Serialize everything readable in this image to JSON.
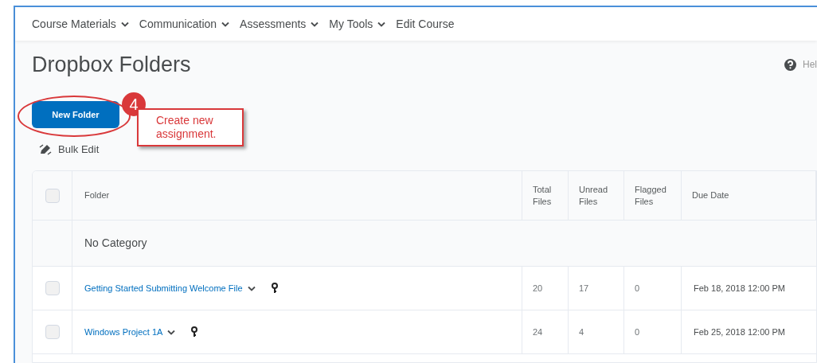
{
  "nav": [
    {
      "label": "Course Materials",
      "dropdown": true
    },
    {
      "label": "Communication",
      "dropdown": true
    },
    {
      "label": "Assessments",
      "dropdown": true
    },
    {
      "label": "My Tools",
      "dropdown": true
    },
    {
      "label": "Edit Course",
      "dropdown": false
    }
  ],
  "title": "Dropbox Folders",
  "help": "Hel",
  "new_folder_button": "New Folder",
  "annotation": {
    "step": "4",
    "text": "Create new assignment."
  },
  "bulk_edit": "Bulk Edit",
  "table": {
    "select_all_checked": false,
    "columns": [
      "Folder",
      "Total Files",
      "Unread Files",
      "Flagged Files",
      "Due Date"
    ],
    "category": "No Category",
    "rows": [
      {
        "checked": false,
        "folder": "Getting Started Submitting Welcome File",
        "total": "20",
        "unread": "17",
        "flagged": "0",
        "due": "Feb 18, 2018 12:00 PM"
      },
      {
        "checked": false,
        "folder": "Windows Project 1A",
        "total": "24",
        "unread": "4",
        "flagged": "0",
        "due": "Feb 25, 2018 12:00 PM"
      }
    ]
  }
}
